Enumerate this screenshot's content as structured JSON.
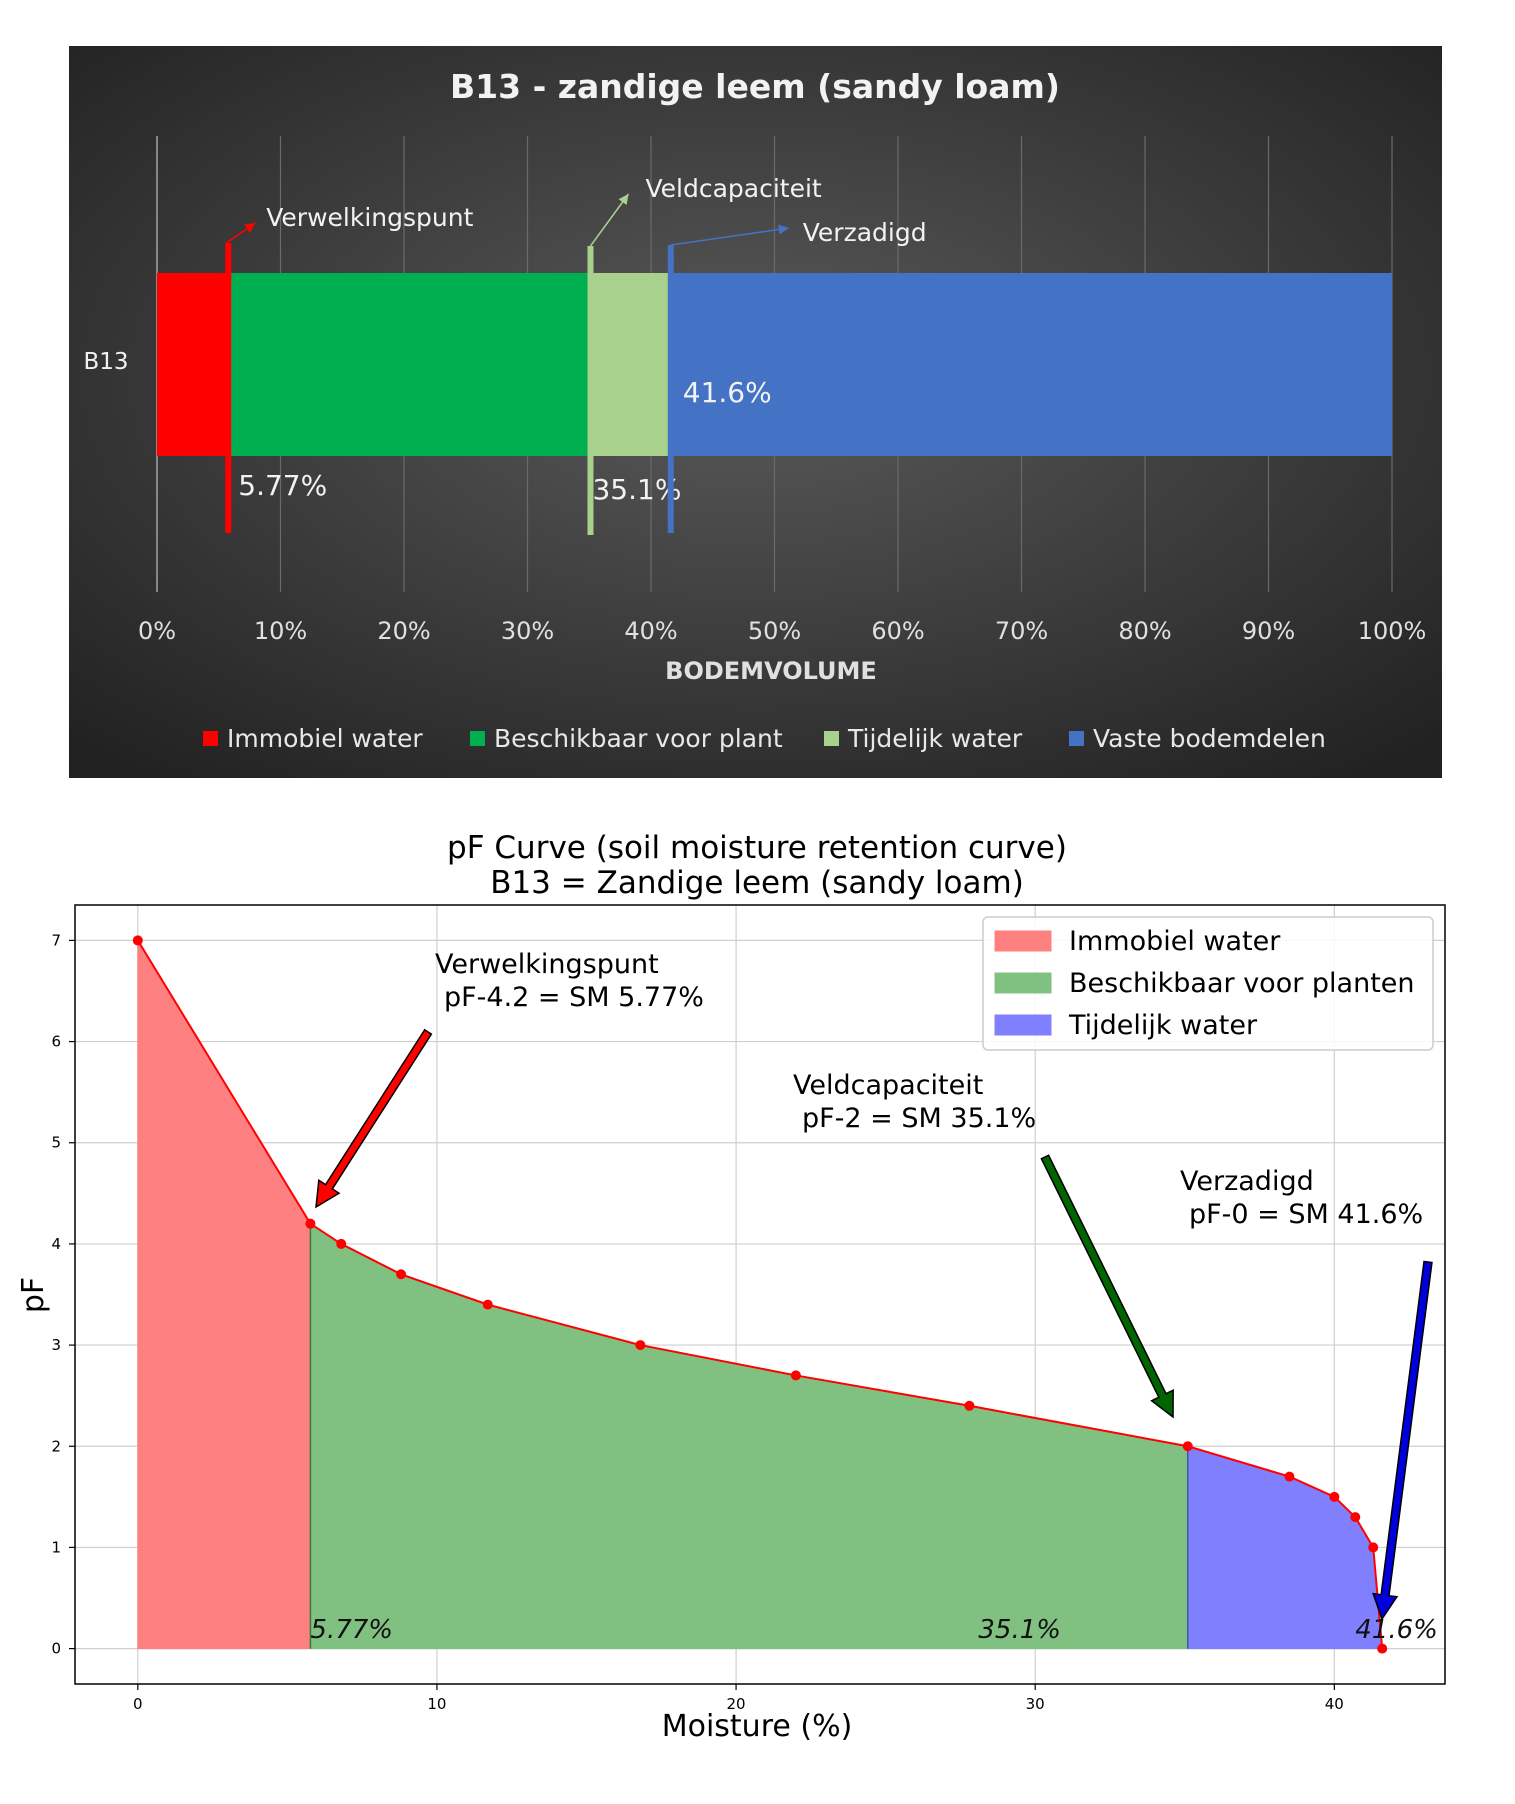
{
  "chart_data": [
    {
      "type": "bar",
      "orientation": "horizontal",
      "stacked": true,
      "title": "B13 - zandige leem (sandy loam)",
      "xlabel": "BODEMVOLUME",
      "ylabel": "",
      "categories": [
        "B13"
      ],
      "xlim": [
        0,
        100
      ],
      "x_tick_labels": [
        "0%",
        "10%",
        "20%",
        "30%",
        "40%",
        "50%",
        "60%",
        "70%",
        "80%",
        "90%",
        "100%"
      ],
      "grid": "vertical",
      "legend_position": "bottom",
      "series": [
        {
          "name": "Immobiel water",
          "values": [
            5.77
          ],
          "color": "#ff0000"
        },
        {
          "name": "Beschikbaar voor plant",
          "values": [
            29.33
          ],
          "color": "#00b050"
        },
        {
          "name": "Tijdelijk water",
          "values": [
            6.5
          ],
          "color": "#a9d18e"
        },
        {
          "name": "Vaste bodemdelen",
          "values": [
            58.4
          ],
          "color": "#4472c4"
        }
      ],
      "markers": [
        {
          "label": "Verwelkingspunt",
          "x": 5.77,
          "value_label": "5.77%",
          "color": "#ff0000"
        },
        {
          "label": "Veldcapaciteit",
          "x": 35.1,
          "value_label": "35.1%",
          "color": "#a9d18e"
        },
        {
          "label": "Verzadigd",
          "x": 41.6,
          "value_label": "41.6%",
          "color": "#4472c4"
        }
      ],
      "background": "#404040"
    },
    {
      "type": "area",
      "title": "pF Curve (soil moisture retention curve)",
      "subtitle": "B13 = Zandige leem (sandy loam)",
      "xlabel": "Moisture (%)",
      "ylabel": "pF",
      "xlim": [
        -2.1,
        43.7
      ],
      "ylim": [
        -0.35,
        7.35
      ],
      "x_ticks": [
        0,
        10,
        20,
        30,
        40
      ],
      "y_ticks": [
        0,
        1,
        2,
        3,
        4,
        5,
        6,
        7
      ],
      "grid": true,
      "legend_position": "top-right",
      "x": [
        0,
        5.77,
        6.8,
        8.8,
        11.7,
        16.8,
        22,
        27.8,
        35.1,
        38.5,
        40,
        40.7,
        41.3,
        41.6
      ],
      "y": [
        7,
        4.2,
        4.0,
        3.7,
        3.4,
        3.0,
        2.7,
        2.4,
        2.0,
        1.7,
        1.5,
        1.3,
        1.0,
        0
      ],
      "line_color": "#ff0000",
      "regions": [
        {
          "name": "Immobiel water",
          "x_range": [
            0,
            5.77
          ],
          "color": "#ff8080"
        },
        {
          "name": "Beschikbaar voor planten",
          "x_range": [
            5.77,
            35.1
          ],
          "color": "#80c080"
        },
        {
          "name": "Tijdelijk water",
          "x_range": [
            35.1,
            41.6
          ],
          "color": "#8080ff"
        }
      ],
      "region_labels": [
        "5.77%",
        "35.1%",
        "41.6%"
      ],
      "annotations": [
        {
          "line1": "Verwelkingspunt",
          "line2": "pF-4.2 = SM 5.77%",
          "color": "#ff0000",
          "target_x": 5.77,
          "target_y": 4.2
        },
        {
          "line1": "Veldcapaciteit",
          "line2": "pF-2 = SM 35.1%",
          "color": "#006400",
          "target_x": 35.1,
          "target_y": 2.0
        },
        {
          "line1": "Verzadigd",
          "line2": "pF-0 = SM 41.6%",
          "color": "#0000dd",
          "target_x": 41.6,
          "target_y": 0
        }
      ]
    }
  ]
}
